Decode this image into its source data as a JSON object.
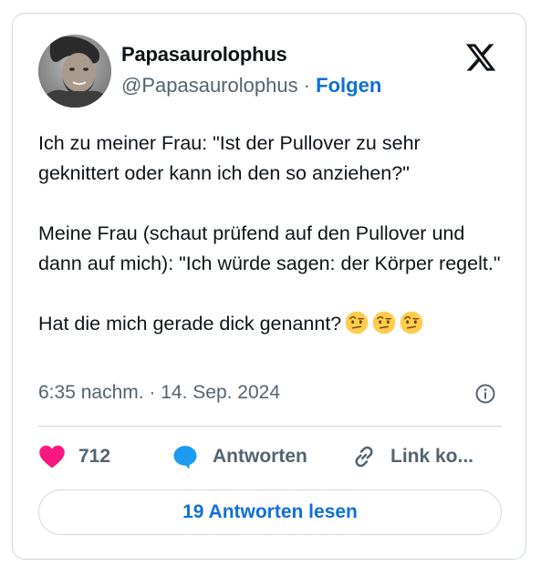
{
  "author": {
    "name": "Papasaurolophus",
    "handle": "@Papasaurolophus",
    "separator": "·",
    "follow_label": "Folgen"
  },
  "tweet": {
    "paragraphs": [
      "Ich zu meiner Frau: \"Ist der Pullover zu sehr geknittert oder kann ich den so anziehen?\"",
      "Meine Frau (schaut prüfend auf den Pullover und dann auf mich): \"Ich würde sagen: der Körper regelt.\"",
      "Hat die mich gerade dick genannt?"
    ],
    "emojis": [
      "face-with-raised-eyebrow-emoji",
      "face-with-raised-eyebrow-emoji",
      "face-with-raised-eyebrow-emoji"
    ],
    "timestamp": "6:35 nachm. · 14. Sep. 2024"
  },
  "actions": {
    "like_count": "712",
    "reply_label": "Antworten",
    "copy_link_label": "Link ko..."
  },
  "read_replies_label": "19 Antworten lesen",
  "colors": {
    "accent": "#0f6fd8",
    "like": "#f91880",
    "reply": "#1d9bf0",
    "secondary_text": "#536471",
    "border": "#cfd9de"
  },
  "icons": {
    "brand": "x-logo-icon",
    "info": "info-icon",
    "like": "heart-icon",
    "reply": "speech-bubble-icon",
    "copy": "link-icon"
  }
}
